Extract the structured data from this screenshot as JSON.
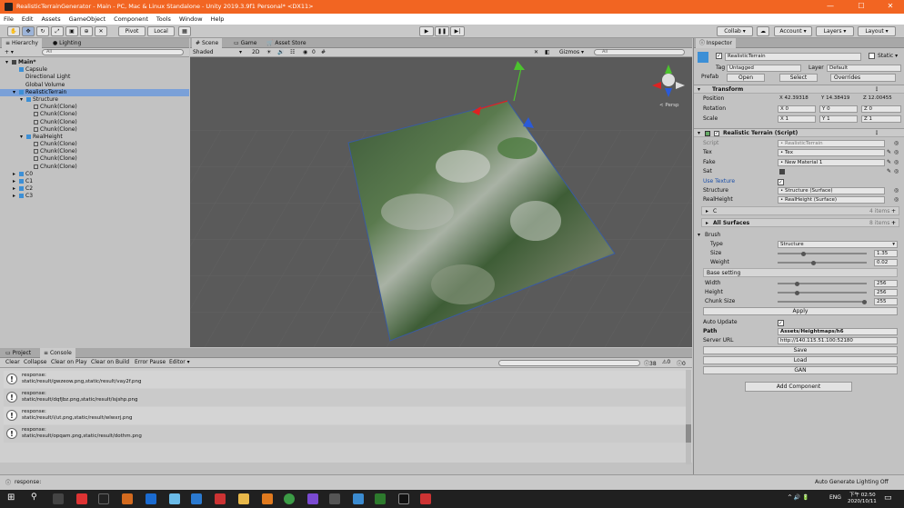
{
  "title": "RealisticTerrainGenerator - Main - PC, Mac & Linux Standalone - Unity 2019.3.9f1 Personal* <DX11>",
  "window_controls": [
    "—",
    "☐",
    "✕"
  ],
  "menu": [
    "File",
    "Edit",
    "Assets",
    "GameObject",
    "Component",
    "Tools",
    "Window",
    "Help"
  ],
  "toolbar": {
    "pivot": "Pivot",
    "local": "Local",
    "collab": "Collab ▾",
    "account": "Account",
    "layers": "Layers",
    "layout": "Layout"
  },
  "hierarchy": {
    "tab": "Hierarchy",
    "tab2": "Lighting",
    "add": "+ ▾",
    "search_placeholder": "All",
    "items": [
      {
        "label": "Main*",
        "depth": 0,
        "kind": "scene"
      },
      {
        "label": "Capsule",
        "depth": 1,
        "kind": "cube"
      },
      {
        "label": "Directional Light",
        "depth": 1,
        "kind": "none"
      },
      {
        "label": "Global Volume",
        "depth": 1,
        "kind": "none"
      },
      {
        "label": "RealisticTerrain",
        "depth": 1,
        "kind": "cube",
        "selected": true
      },
      {
        "label": "Structure",
        "depth": 2,
        "kind": "cube"
      },
      {
        "label": "Chunk(Clone)",
        "depth": 3,
        "kind": "gcube"
      },
      {
        "label": "Chunk(Clone)",
        "depth": 3,
        "kind": "gcube"
      },
      {
        "label": "Chunk(Clone)",
        "depth": 3,
        "kind": "gcube"
      },
      {
        "label": "Chunk(Clone)",
        "depth": 3,
        "kind": "gcube"
      },
      {
        "label": "RealHeight",
        "depth": 2,
        "kind": "cube"
      },
      {
        "label": "Chunk(Clone)",
        "depth": 3,
        "kind": "gcube"
      },
      {
        "label": "Chunk(Clone)",
        "depth": 3,
        "kind": "gcube"
      },
      {
        "label": "Chunk(Clone)",
        "depth": 3,
        "kind": "gcube"
      },
      {
        "label": "Chunk(Clone)",
        "depth": 3,
        "kind": "gcube"
      },
      {
        "label": "C0",
        "depth": 1,
        "kind": "cube"
      },
      {
        "label": "C1",
        "depth": 1,
        "kind": "cube"
      },
      {
        "label": "C2",
        "depth": 1,
        "kind": "cube"
      },
      {
        "label": "C3",
        "depth": 1,
        "kind": "cube"
      }
    ]
  },
  "scene": {
    "tabs": [
      "Scene",
      "Game",
      "Asset Store"
    ],
    "shading": "Shaded",
    "mode2d": "2D",
    "gizmos": "Gizmos ▾",
    "search_placeholder": "All",
    "layers_count": "0",
    "persp": "< Persp"
  },
  "bottom": {
    "tabs": [
      "Project",
      "Console"
    ],
    "buttons": [
      "Clear",
      "Collapse",
      "Clear on Play",
      "Clear on Build",
      "Error Pause",
      "Editor ▾"
    ],
    "counts": [
      "38",
      "0",
      "0"
    ],
    "logs": [
      {
        "l1": "response:",
        "l2": "static/result/gwzeow.png,static/result/vay2f.png"
      },
      {
        "l1": "response:",
        "l2": "static/result/dqfjbz.png,static/result/isjshp.png"
      },
      {
        "l1": "response:",
        "l2": "static/result/i/ut.png,static/result/wlwxrj.png"
      },
      {
        "l1": "response:",
        "l2": "static/result/opqam.png,static/result/dothm.png"
      }
    ],
    "status": "response:",
    "lighting_status": "Auto Generate Lighting Off"
  },
  "inspector": {
    "tab": "Inspector",
    "object_name": "RealisticTerrain",
    "static": "Static ▾",
    "tag_label": "Tag",
    "tag": "Untagged",
    "layer_label": "Layer",
    "layer": "Default",
    "prefab_label": "Prefab",
    "open": "Open",
    "select": "Select",
    "overrides": "Overrides",
    "transform": "Transform",
    "position_label": "Position",
    "rotation_label": "Rotation",
    "scale_label": "Scale",
    "position": [
      "X 42.39318",
      "Y 14.38419",
      "Z 12.00455"
    ],
    "rotation": [
      "X 0",
      "Y 0",
      "Z 0"
    ],
    "scale": [
      "X 1",
      "Y 1",
      "Z 1"
    ],
    "script_title": "Realistic Terrain (Script)",
    "fields": [
      {
        "label": "Script",
        "value": "RealisticTerrain"
      },
      {
        "label": "Tex",
        "value": "Tex"
      },
      {
        "label": "Fake",
        "value": "New Material 1"
      },
      {
        "label": "Sat",
        "value": ""
      },
      {
        "label": "Use Texture",
        "value": "✓"
      },
      {
        "label": "Structure",
        "value": "Structure (Surface)"
      },
      {
        "label": "RealHeight",
        "value": "RealHeight (Surface)"
      }
    ],
    "c_label": "C",
    "c_items": "4 items",
    "all_surfaces": "All Surfaces",
    "all_surfaces_items": "8 items",
    "brush": "Brush",
    "type_label": "Type",
    "type": "Structure",
    "size_label": "Size",
    "size": "1.35",
    "size_frac": 0.28,
    "weight_label": "Weight",
    "weight": "0.02",
    "weight_frac": 0.4,
    "base_setting": "Base setting",
    "width_label": "Width",
    "width": "256",
    "width_frac": 0.2,
    "height_label": "Height",
    "height": "256",
    "height_frac": 0.2,
    "chunk_label": "Chunk Size",
    "chunk": "255",
    "chunk_frac": 1.0,
    "apply": "Apply",
    "auto_update_label": "Auto Update",
    "auto_update": "✓",
    "path_label": "Path",
    "path": "Assets/Heightmaps/h6",
    "server_label": "Server URL",
    "server": "http://140.115.51.100:52180",
    "save": "Save",
    "load": "Load",
    "gan": "GAN",
    "add_component": "Add Component"
  },
  "taskbar": {
    "lang": "ENG",
    "time": "下午 02:50",
    "date": "2020/10/11",
    "tray": "^ 🔊 🔋"
  },
  "colors": {
    "accent": "#f26522",
    "selection": "#7aa0d8",
    "scene_bg": "#5a5a5a"
  }
}
